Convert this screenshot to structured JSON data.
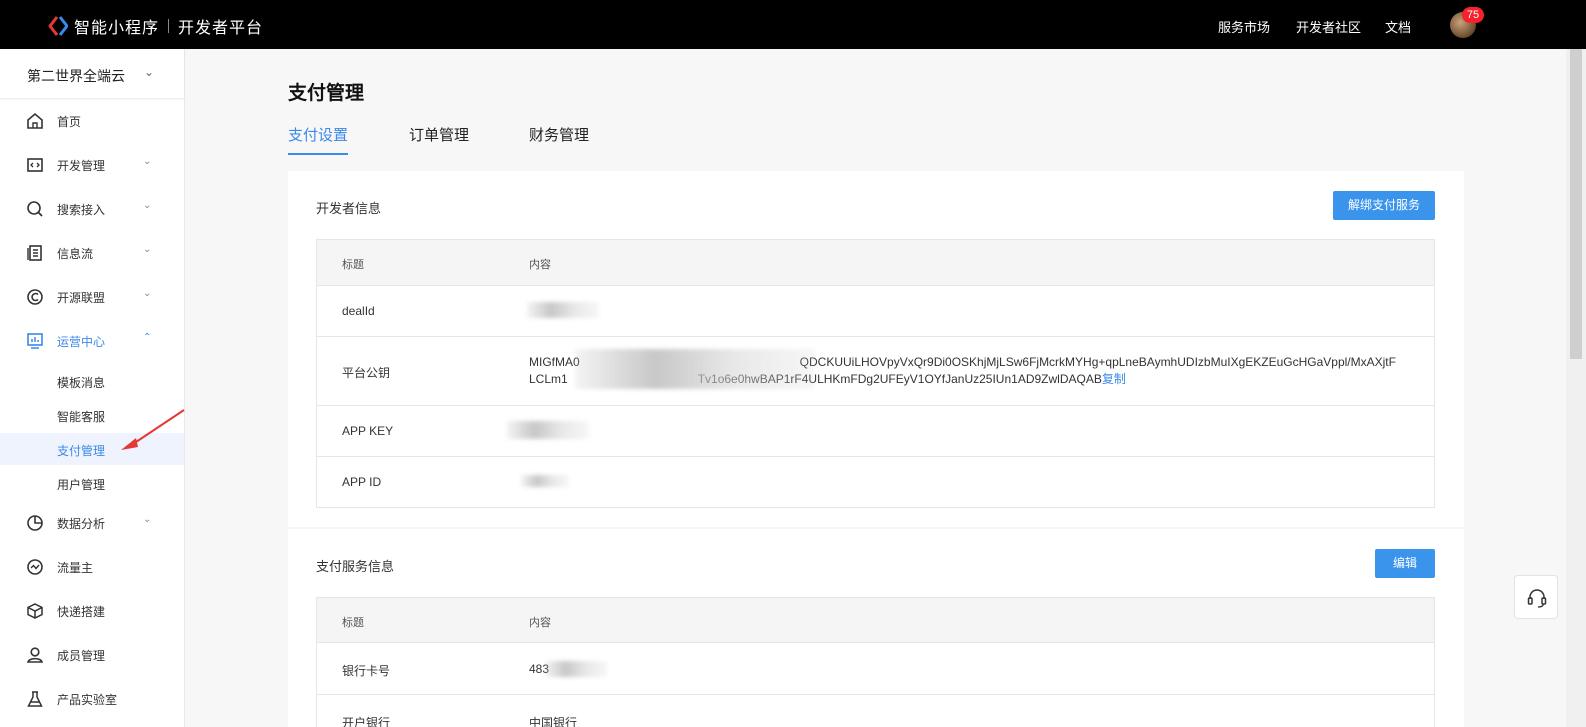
{
  "topbar": {
    "brand": "智能小程序",
    "subtitle": "开发者平台",
    "nav": [
      "服务市场",
      "开发者社区",
      "文档"
    ],
    "notification_count": "75"
  },
  "sidebar": {
    "org": "第二世界全端云",
    "items": [
      {
        "label": "首页",
        "icon": "home-icon",
        "expandable": false
      },
      {
        "label": "开发管理",
        "icon": "code-icon",
        "expandable": true
      },
      {
        "label": "搜索接入",
        "icon": "search-icon",
        "expandable": true
      },
      {
        "label": "信息流",
        "icon": "feed-icon",
        "expandable": true
      },
      {
        "label": "开源联盟",
        "icon": "alliance-icon",
        "expandable": true
      },
      {
        "label": "运营中心",
        "icon": "dashboard-icon",
        "expandable": true,
        "expanded": true
      },
      {
        "label": "数据分析",
        "icon": "pie-chart-icon",
        "expandable": true
      },
      {
        "label": "流量主",
        "icon": "trend-icon",
        "expandable": false
      },
      {
        "label": "快递搭建",
        "icon": "cube-icon",
        "expandable": false
      },
      {
        "label": "成员管理",
        "icon": "user-icon",
        "expandable": false
      },
      {
        "label": "产品实验室",
        "icon": "flask-icon",
        "expandable": false
      }
    ],
    "sub_items": [
      "模板消息",
      "智能客服",
      "支付管理",
      "用户管理"
    ],
    "selected_sub": "支付管理"
  },
  "main": {
    "title": "支付管理",
    "tabs": [
      "支付设置",
      "订单管理",
      "财务管理"
    ],
    "active_tab": "支付设置",
    "dev_card": {
      "title": "开发者信息",
      "action": "解绑支付服务",
      "headers": [
        "标题",
        "内容"
      ],
      "rows": [
        {
          "title": "dealId",
          "value": ""
        },
        {
          "title": "平台公钥",
          "value_line1_start": "MIGfMA0",
          "value_line1_end": "QDCKUUiLHOVpyVxQr9Di0OSKhjMjLSw6FjMcrkMYHg+qpLneBAymhUDIzbMuIXgEKZEuGcHGaVppl/MxAXjtF",
          "value_line2_start": "LCLm1",
          "value_line2_end": "Tv1o6e0hwBAP1rF4ULHKmFDg2UFEyV1OYfJanUz25IUn1AD9ZwlDAQAB",
          "copy": "复制"
        },
        {
          "title": "APP KEY",
          "value": ""
        },
        {
          "title": "APP ID",
          "value": ""
        }
      ]
    },
    "pay_card": {
      "title": "支付服务信息",
      "action": "编辑",
      "headers": [
        "标题",
        "内容"
      ],
      "rows": [
        {
          "title": "银行卡号",
          "value": "483"
        },
        {
          "title": "开户银行",
          "value": "中国银行"
        }
      ]
    }
  },
  "colors": {
    "accent": "#3b89e8",
    "button": "#3b94ec",
    "topbar": "#000000",
    "badge": "#f5222d"
  }
}
